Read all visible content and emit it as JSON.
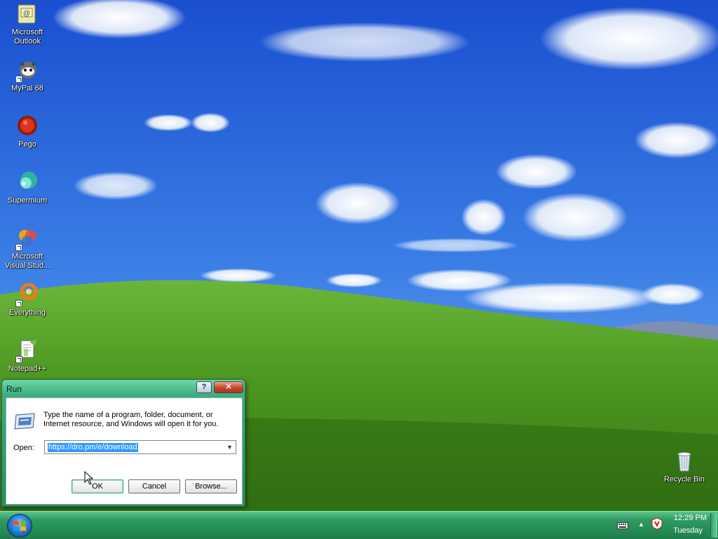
{
  "desktop": {
    "icons": [
      {
        "label": "Microsoft Outlook",
        "icon": "outlook-icon",
        "shortcut": false
      },
      {
        "label": "MyPal 68",
        "icon": "mypal-icon",
        "shortcut": true
      },
      {
        "label": "Pego",
        "icon": "pego-icon",
        "shortcut": false
      },
      {
        "label": "Supermium",
        "icon": "supermium-icon",
        "shortcut": false
      },
      {
        "label": "Microsoft Visual Stud...",
        "icon": "visual-studio-icon",
        "shortcut": true
      },
      {
        "label": "Everything",
        "icon": "everything-icon",
        "shortcut": true
      },
      {
        "label": "Notepad++",
        "icon": "notepadpp-icon",
        "shortcut": true
      }
    ],
    "recycle_bin": {
      "label": "Recycle Bin",
      "icon": "recycle-bin-icon"
    }
  },
  "run_dialog": {
    "title": "Run",
    "help_label": "?",
    "close_label": "✕",
    "description": "Type the name of a program, folder, document, or Internet resource, and Windows will open it for you.",
    "open_label": "Open:",
    "open_value": "https://dro.pm/e/download",
    "ok_label": "OK",
    "cancel_label": "Cancel",
    "browse_label": "Browse..."
  },
  "taskbar": {
    "start_icon": "windows-logo-icon",
    "tray_icons": [
      "keyboard-icon",
      "show-hidden-icon",
      "tray-app-icon"
    ],
    "clock_time": "12:29 PM",
    "clock_day": "Tuesday"
  },
  "colors": {
    "titlebar": "#3cae7f",
    "taskbar": "#2e9b62",
    "selection": "#3399ff"
  }
}
